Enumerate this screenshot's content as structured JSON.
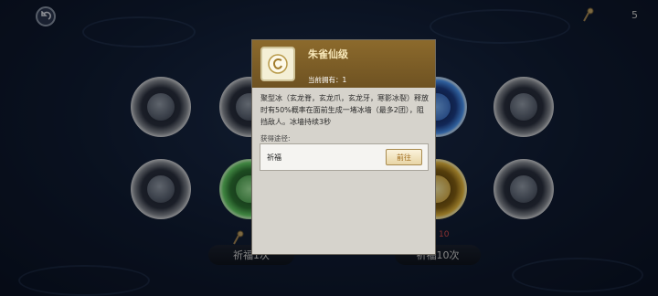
{
  "hud": {
    "back_icon": "back-arrow-icon",
    "currency_icon": "bell-wand-icon",
    "currency_count": "5"
  },
  "orbs": [
    {
      "name": "orb-r1-c1",
      "color": "silver",
      "icon": "scale-icon"
    },
    {
      "name": "orb-r1-c2",
      "color": "silver",
      "icon": "scale-icon"
    },
    {
      "name": "orb-r1-c4",
      "color": "blue",
      "icon": "orb-icon"
    },
    {
      "name": "orb-r1-c5",
      "color": "silver",
      "icon": "claw-icon"
    },
    {
      "name": "orb-r2-c1",
      "color": "silver",
      "icon": "scale-icon"
    },
    {
      "name": "orb-r2-c2",
      "color": "green",
      "icon": "orb-icon"
    },
    {
      "name": "orb-r2-c4",
      "color": "gold",
      "icon": "orb-icon"
    },
    {
      "name": "orb-r2-c5",
      "color": "silver",
      "icon": "fang-icon"
    }
  ],
  "pray_left": {
    "label": "祈福1次"
  },
  "pray_right": {
    "label": "祈福10次",
    "cost": "10"
  },
  "popup": {
    "item_name": "朱雀仙级",
    "item_icon": "vermilion-bird-icon",
    "owned": "当前拥有：1",
    "description": "聚型冰（玄龙脊，玄龙爪，玄龙牙，寒影冰裂）释放时有50%概率在面前生成一堵冰墙（最多2团），阻挡敌人。冰墙持续3秒",
    "source_label": "获得途径:",
    "source_name": "祈福",
    "goto_label": "前往"
  },
  "colors": {
    "popup_header": "#7c5e28",
    "popup_body": "#d6d3cc",
    "goto_text": "#a06a1a",
    "background": "#101c33"
  }
}
